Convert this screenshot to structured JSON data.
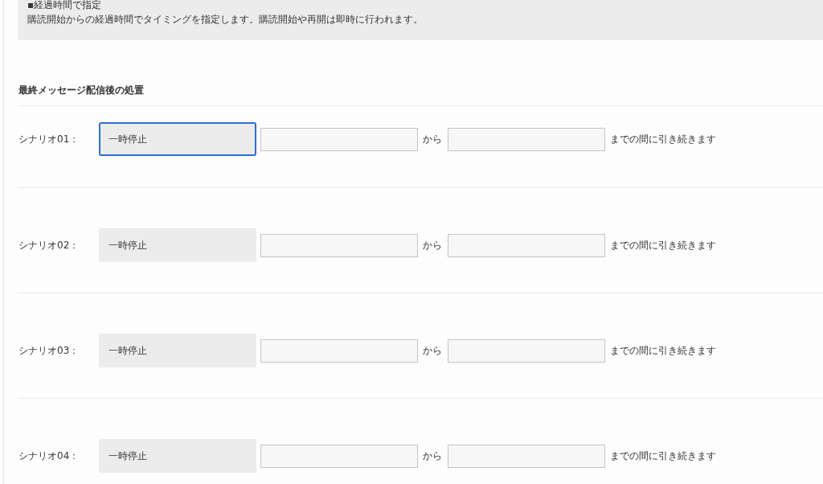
{
  "info_box": {
    "title": "▪経過時間で指定",
    "description": "購読開始からの経過時間でタイミングを指定します。購読開始や再開は即時に行われます。"
  },
  "section": {
    "heading": "最終メッセージ配信後の処置",
    "rows": [
      {
        "label": "シナリオ01：",
        "action": "一時停止",
        "focused": true,
        "connector": "から",
        "suffix": "までの間に引き続きます"
      },
      {
        "label": "シナリオ02：",
        "action": "一時停止",
        "focused": false,
        "connector": "から",
        "suffix": "までの間に引き続きます"
      },
      {
        "label": "シナリオ03：",
        "action": "一時停止",
        "focused": false,
        "connector": "から",
        "suffix": "までの間に引き続きます"
      },
      {
        "label": "シナリオ04：",
        "action": "一時停止",
        "focused": false,
        "connector": "から",
        "suffix": "までの間に引き続きます"
      }
    ]
  }
}
